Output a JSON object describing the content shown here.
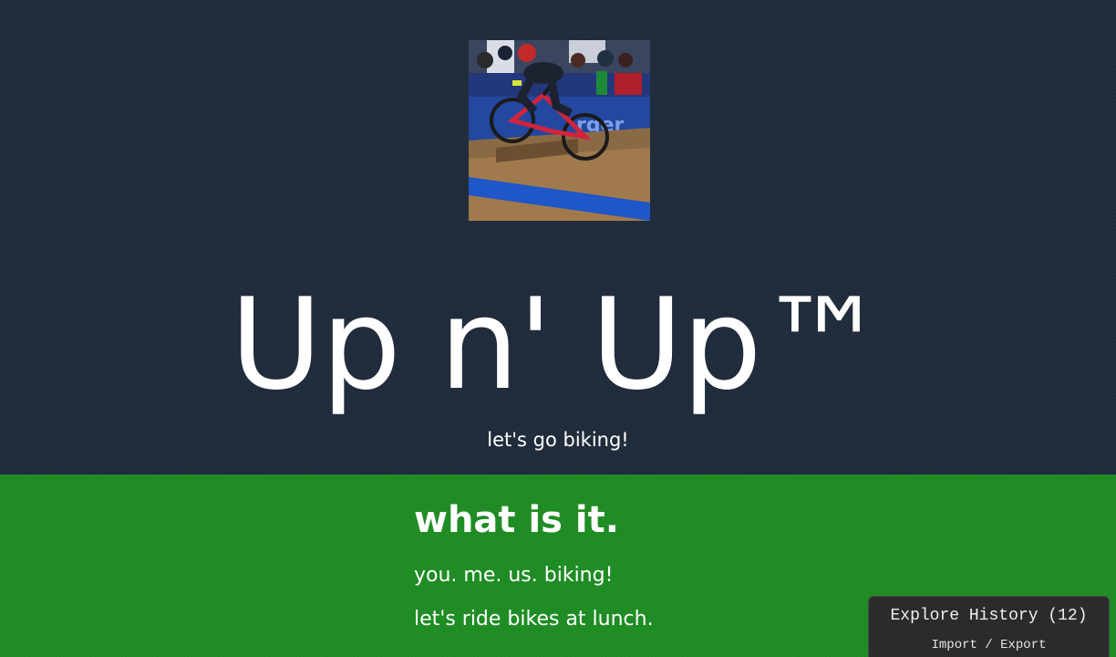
{
  "hero": {
    "photo_icon": "cyclocross-rider-photo",
    "title": "Up n' Up™",
    "tagline": "let's go biking!"
  },
  "about": {
    "heading": "what is it.",
    "lines": [
      "you. me. us. biking!",
      "let's ride bikes at lunch."
    ]
  },
  "history_panel": {
    "title": "Explore History (12)",
    "subtitle": "Import / Export"
  },
  "colors": {
    "hero_bg": "#1f2b3b",
    "about_bg": "#1d8b22",
    "panel_bg": "#2b2b2b",
    "text": "#ffffff"
  }
}
